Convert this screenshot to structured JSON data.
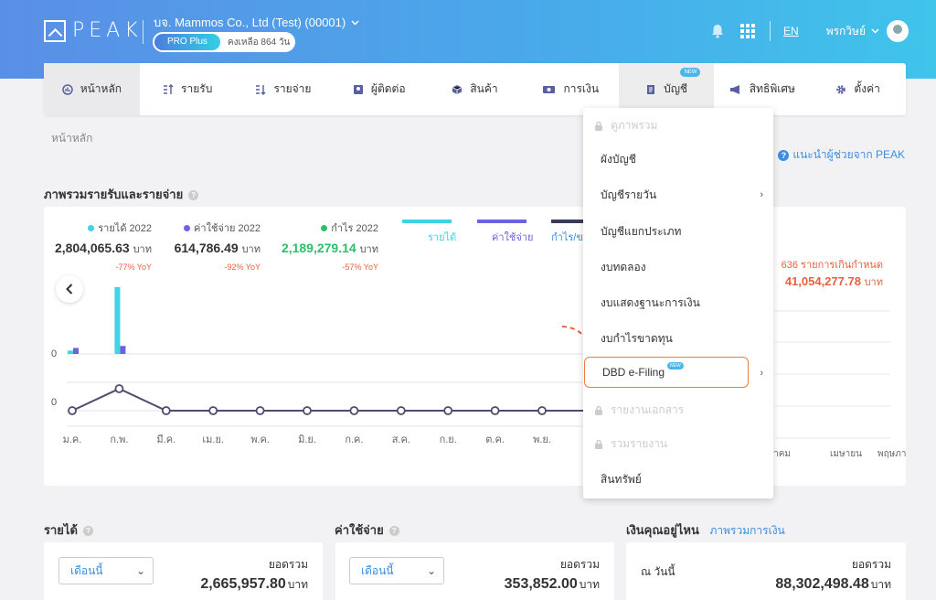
{
  "header": {
    "logo_text": "PEAK",
    "company": "บจ. Mammos Co., Ltd (Test) (00001)",
    "plan": "PRO Plus",
    "remaining": "คงเหลือ 864 วัน",
    "lang": "EN",
    "user": "พรกวิษย์"
  },
  "nav": {
    "items": [
      {
        "label": "หน้าหลัก",
        "icon": "dashboard-icon"
      },
      {
        "label": "รายรับ",
        "icon": "income-icon"
      },
      {
        "label": "รายจ่าย",
        "icon": "expense-icon"
      },
      {
        "label": "ผู้ติดต่อ",
        "icon": "contacts-icon"
      },
      {
        "label": "สินค้า",
        "icon": "box-icon"
      },
      {
        "label": "การเงิน",
        "icon": "money-icon"
      },
      {
        "label": "บัญชี",
        "icon": "ledger-icon",
        "badge": "NEW"
      },
      {
        "label": "สิทธิพิเศษ",
        "icon": "megaphone-icon"
      },
      {
        "label": "ตั้งค่า",
        "icon": "gear-icon"
      }
    ]
  },
  "breadcrumb": "หน้าหลัก",
  "help_link": "แนะนำผู้ช่วยจาก PEAK",
  "overview": {
    "title": "ภาพรวมรายรับและรายจ่าย",
    "stats": [
      {
        "label": "รายได้ 2022",
        "value": "2,804,065.63",
        "unit": "บาท",
        "yoy": "-77% YoY",
        "color": "#3fd3e6"
      },
      {
        "label": "ค่าใช้จ่าย 2022",
        "value": "614,786.49",
        "unit": "บาท",
        "yoy": "-92% YoY",
        "color": "#6c63e0"
      },
      {
        "label": "กำไร 2022",
        "value": "2,189,279.14",
        "unit": "บาท",
        "yoy": "-57% YoY",
        "color": "#2dbf6a"
      }
    ],
    "legend": [
      {
        "label": "รายได้",
        "color": "#3fd3e6"
      },
      {
        "label": "ค่าใช้จ่าย",
        "color": "#6c63e0"
      },
      {
        "label": "กำไร/ขา",
        "color": "#3a3a5a"
      }
    ],
    "right_note": "636 รายการเกินกำหนด",
    "right_value": "41,054,277.78",
    "right_unit": "บาท",
    "right_months": [
      "ลาคม",
      "เมษายน",
      "พฤษภาคม"
    ]
  },
  "chart_data": {
    "type": "bar",
    "categories": [
      "ม.ค.",
      "ก.พ.",
      "มี.ค.",
      "เม.ย.",
      "พ.ค.",
      "มิ.ย.",
      "ก.ค.",
      "ส.ค.",
      "ก.ย.",
      "ต.ค.",
      "พ.ย."
    ],
    "zero_label": "0",
    "series": [
      {
        "name": "รายได้",
        "values": [
          0.05,
          1.0,
          0,
          0,
          0,
          0,
          0,
          0,
          0,
          0,
          0
        ],
        "color": "#3fd3e6"
      },
      {
        "name": "ค่าใช้จ่าย",
        "values": [
          0.09,
          0.12,
          0,
          0,
          0,
          0,
          0,
          0,
          0,
          0,
          0
        ],
        "color": "#6c63e0"
      },
      {
        "name": "กำไร/ขาดทุน",
        "type": "line",
        "values": [
          0,
          1.0,
          0,
          0,
          0,
          0,
          0,
          0,
          0,
          0,
          0
        ],
        "color": "#4f4a6e"
      }
    ]
  },
  "menu": {
    "items": [
      {
        "label": "ดูภาพรวม",
        "disabled": true
      },
      {
        "label": "ผังบัญชี"
      },
      {
        "label": "บัญชีรายวัน",
        "submenu": true
      },
      {
        "label": "บัญชีแยกประเภท"
      },
      {
        "label": "งบทดลอง"
      },
      {
        "label": "งบแสดงฐานะการเงิน"
      },
      {
        "label": "งบกำไรขาดทุน"
      },
      {
        "label": "DBD e-Filing",
        "submenu": true,
        "badge": "NEW",
        "highlight": true
      },
      {
        "label": "รายงานเอกสาร",
        "disabled": true
      },
      {
        "label": "รวมรายงาน",
        "disabled": true
      },
      {
        "label": "สินทรัพย์"
      }
    ]
  },
  "cards": {
    "income": {
      "title": "รายได้",
      "select": "เดือนนี้",
      "total_label": "ยอดรวม",
      "total": "2,665,957.80",
      "unit": "บาท"
    },
    "expense": {
      "title": "ค่าใช้จ่าย",
      "select": "เดือนนี้",
      "total_label": "ยอดรวม",
      "total": "353,852.00",
      "unit": "บาท"
    },
    "money": {
      "title": "เงินคุณอยู่ไหน",
      "link": "ภาพรวมการเงิน",
      "date_label": "ณ วันนี้",
      "total_label": "ยอดรวม",
      "total": "88,302,498.48",
      "unit": "บาท"
    }
  }
}
